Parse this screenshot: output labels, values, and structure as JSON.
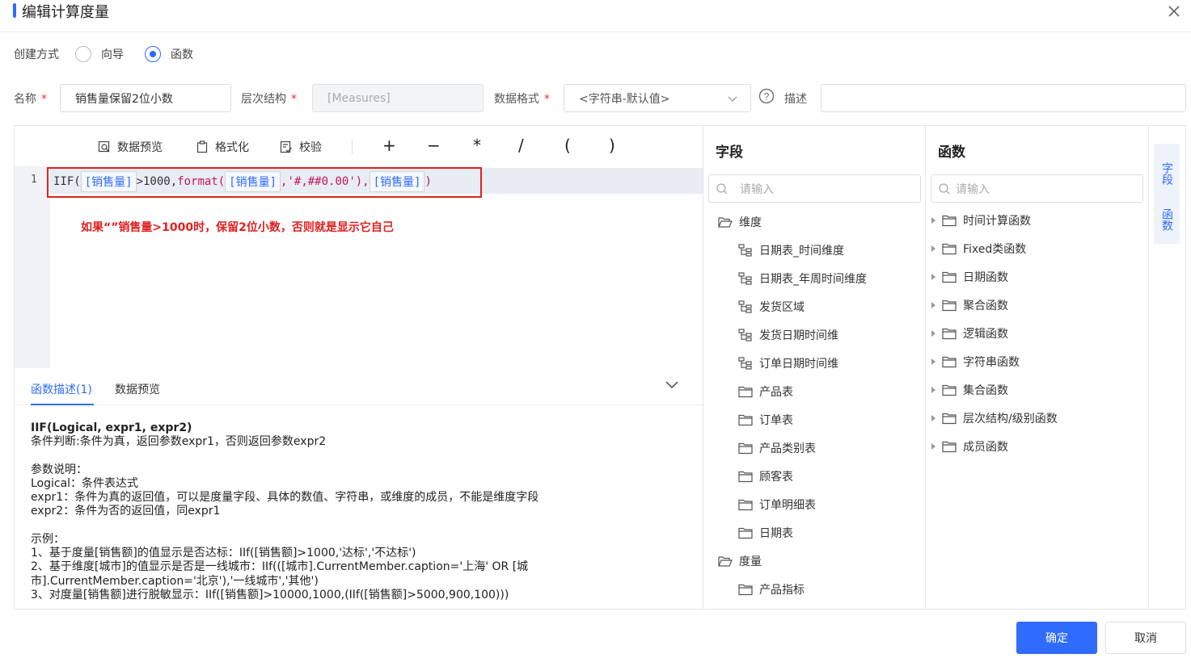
{
  "dialog": {
    "title": "编辑计算度量"
  },
  "create_mode": {
    "label": "创建方式",
    "options": [
      {
        "label": "向导",
        "selected": false
      },
      {
        "label": "函数",
        "selected": true
      }
    ]
  },
  "form": {
    "name_label": "名称",
    "name_value": "销售量保留2位小数",
    "hierarchy_label": "层次结构",
    "hierarchy_value": "[Measures]",
    "format_label": "数据格式",
    "format_value": "<字符串-默认值>",
    "desc_label": "描述",
    "desc_value": "",
    "required_mark": "*"
  },
  "toolbar": {
    "preview_label": "数据预览",
    "format_label": "格式化",
    "validate_label": "校验",
    "operators": [
      "+",
      "−",
      "*",
      "/",
      "(",
      ")"
    ]
  },
  "editor": {
    "line_number": "1",
    "code": {
      "t1": "IIF(",
      "tok1": "[销售量]",
      "t2": ">1000,",
      "fn": "format(",
      "tok2": "[销售量]",
      "str": ",'#,##0.00'),",
      "tok3": "[销售量]",
      "t3": ")"
    },
    "annotation": "如果“”销售量>1000时，保留2位小数，否则就是显示它自己"
  },
  "desc_tabs": {
    "active": "函数描述(1)",
    "other": "数据预览"
  },
  "description": {
    "signature": "IIF(Logical, expr1, expr2)",
    "summary": "条件判断:条件为真，返回参数expr1，否则返回参数expr2",
    "params_title": "参数说明：",
    "param1": "Logical：条件表达式",
    "param2": "expr1：条件为真的返回值，可以是度量字段、具体的数值、字符串，或维度的成员，不能是维度字段",
    "param3": "expr2：条件为否的返回值，同expr1",
    "examples_title": "示例：",
    "ex1": "1、基于度量[销售额]的值显示是否达标：IIf([销售额]>1000,'达标','不达标')",
    "ex2a": "2、基于维度[城市]的值显示是否是一线城市：IIf(([城市].CurrentMember.caption='上海' OR [城",
    "ex2b": "市].CurrentMember.caption='北京'),'一线城市','其他')",
    "ex3": "3、对度量[销售额]进行脱敏显示：IIf([销售额]>10000,1000,(IIf([销售额]>5000,900,100)))"
  },
  "fields": {
    "title": "字段",
    "search_placeholder": "请输入",
    "dimension_group": "维度",
    "hierarchies": [
      "日期表_时间维度",
      "日期表_年周时间维度",
      "发货区域",
      "发货日期时间维",
      "订单日期时间维"
    ],
    "tables": [
      "产品表",
      "订单表",
      "产品类别表",
      "顾客表",
      "订单明细表",
      "日期表"
    ],
    "measure_group": "度量",
    "partial_item": "产品指标"
  },
  "functions": {
    "title": "函数",
    "search_placeholder": "请输入",
    "items": [
      "时间计算函数",
      "Fixed类函数",
      "日期函数",
      "聚合函数",
      "逻辑函数",
      "字符串函数",
      "集合函数",
      "层次结构/级别函数",
      "成员函数"
    ]
  },
  "side_tabs": {
    "fields": "字段",
    "functions": "函数"
  },
  "footer": {
    "confirm": "确定",
    "cancel": "取消"
  }
}
